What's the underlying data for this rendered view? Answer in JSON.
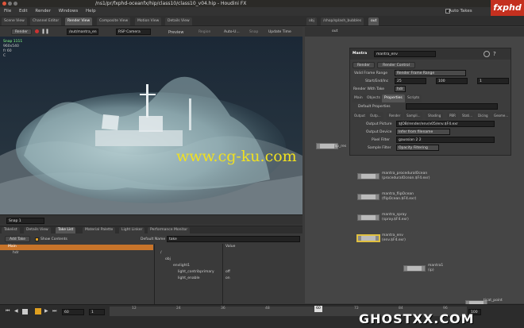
{
  "window": {
    "title": "/ns1/pr/fxphd-oceanfx/hip/class10/class10_v04.hip - Houdini FX"
  },
  "logo": {
    "text": "fxphd"
  },
  "menu": [
    "File",
    "Edit",
    "Render",
    "Windows",
    "Help"
  ],
  "auto_takes": "Auto Takes",
  "left_tabs": [
    "Scene View",
    "Channel Editor",
    "Render View",
    "Composite View",
    "Motion View",
    "Details View"
  ],
  "render_toolbar": {
    "render": "Render",
    "driver": "/out/mantra_en",
    "camera": "RSP Camera",
    "preview": "Preview",
    "region": "Region",
    "auto_update": "Auto-U...",
    "snap": "Snap",
    "update_time": "Update Time"
  },
  "viewport_info": {
    "snap": "Snap 1111",
    "res": "960x540",
    "frame": "fr 60",
    "c": "C"
  },
  "viewport_bottom": {
    "snap_select": "Snap 1"
  },
  "right_tabs": [
    "obj",
    "/shop/splash_bubbles",
    "out"
  ],
  "right_path": "out",
  "mantra": {
    "node_type": "Mantra",
    "node_name": "mantra_env",
    "render_btn": "Render",
    "render_control_btn": "Render Control",
    "valid_frame_range_label": "Valid Frame Range",
    "valid_frame_range_value": "Render Frame Range",
    "start_end_inc_label": "Start/End/Inc",
    "start": "25",
    "end": "100",
    "inc": "1",
    "render_with_take_label": "Render With Take",
    "render_with_take_value": "hdr",
    "tabs": [
      "Main",
      "Objects",
      "Properties",
      "Scripts"
    ],
    "default_properties": "Default Properties",
    "subtabs": [
      "Output",
      "Outp...",
      "Render",
      "Sampli...",
      "Shading",
      "PBR",
      "Stati...",
      "Dicing",
      "Geome..."
    ],
    "output_picture_label": "Output Picture",
    "output_picture_value": "$JOB/render/env/v05/env.$F4.exr",
    "output_device_label": "Output Device",
    "output_device_value": "Infer from filename",
    "pixel_filter_label": "Pixel Filter",
    "pixel_filter_value": "gaussian 2 2",
    "sample_filter_label": "Sample Filter",
    "sample_filter_value": "Opacity Filtering"
  },
  "network_nodes": [
    {
      "name": "flip_res",
      "sub": ""
    },
    {
      "name": "mantra_proceduralOcean",
      "sub": "(proceduralOcean.$F4.exr)"
    },
    {
      "name": "mantra_flipOcean",
      "sub": "(flipOcean.$F4.exr)"
    },
    {
      "name": "mantra_spray",
      "sub": "(spray.$F4.exr)"
    },
    {
      "name": "mantra_env",
      "sub": "(env.$F4.exr)"
    },
    {
      "name": "mantra1",
      "sub": "(ip)"
    },
    {
      "name": "ticat_point",
      "sub": ""
    }
  ],
  "bottom_tabs": [
    "Takelist",
    "Details View",
    "Take List",
    "Material Palette",
    "Light Linker",
    "Performance Monitor"
  ],
  "take_list": {
    "add_take": "Add Take",
    "show_contents": "Show Contents",
    "default_name_label": "Default Name",
    "default_name_value": "take",
    "main": "Main",
    "hdr": "hdr",
    "value_header": "Value",
    "tree": [
      {
        "label": "/",
        "value": ""
      },
      {
        "label": "obj",
        "value": ""
      },
      {
        "label": "envlight1",
        "value": ""
      },
      {
        "label": "light_contribprimary",
        "value": "off"
      },
      {
        "label": "light_enable",
        "value": "on"
      }
    ]
  },
  "timeline": {
    "frame": "60",
    "start": "1",
    "current_marker": "60",
    "end": "100",
    "ticks": [
      "12",
      "24",
      "36",
      "48",
      "60",
      "72",
      "84",
      "96",
      "100"
    ]
  },
  "watermark_center": "www.cg-ku.com",
  "watermark_bottom": "GHOSTXX.COM"
}
